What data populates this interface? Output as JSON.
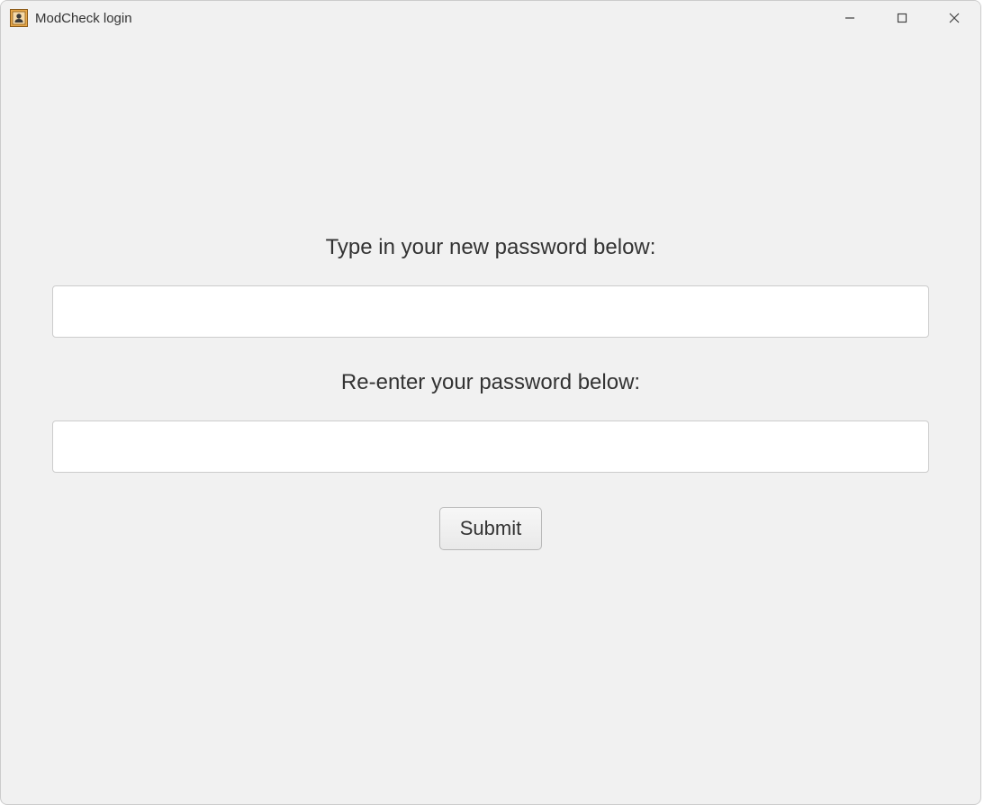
{
  "window": {
    "title": "ModCheck login"
  },
  "form": {
    "new_password_label": "Type in your new password below:",
    "confirm_password_label": "Re-enter your password below:",
    "new_password_value": "",
    "confirm_password_value": "",
    "submit_label": "Submit"
  }
}
